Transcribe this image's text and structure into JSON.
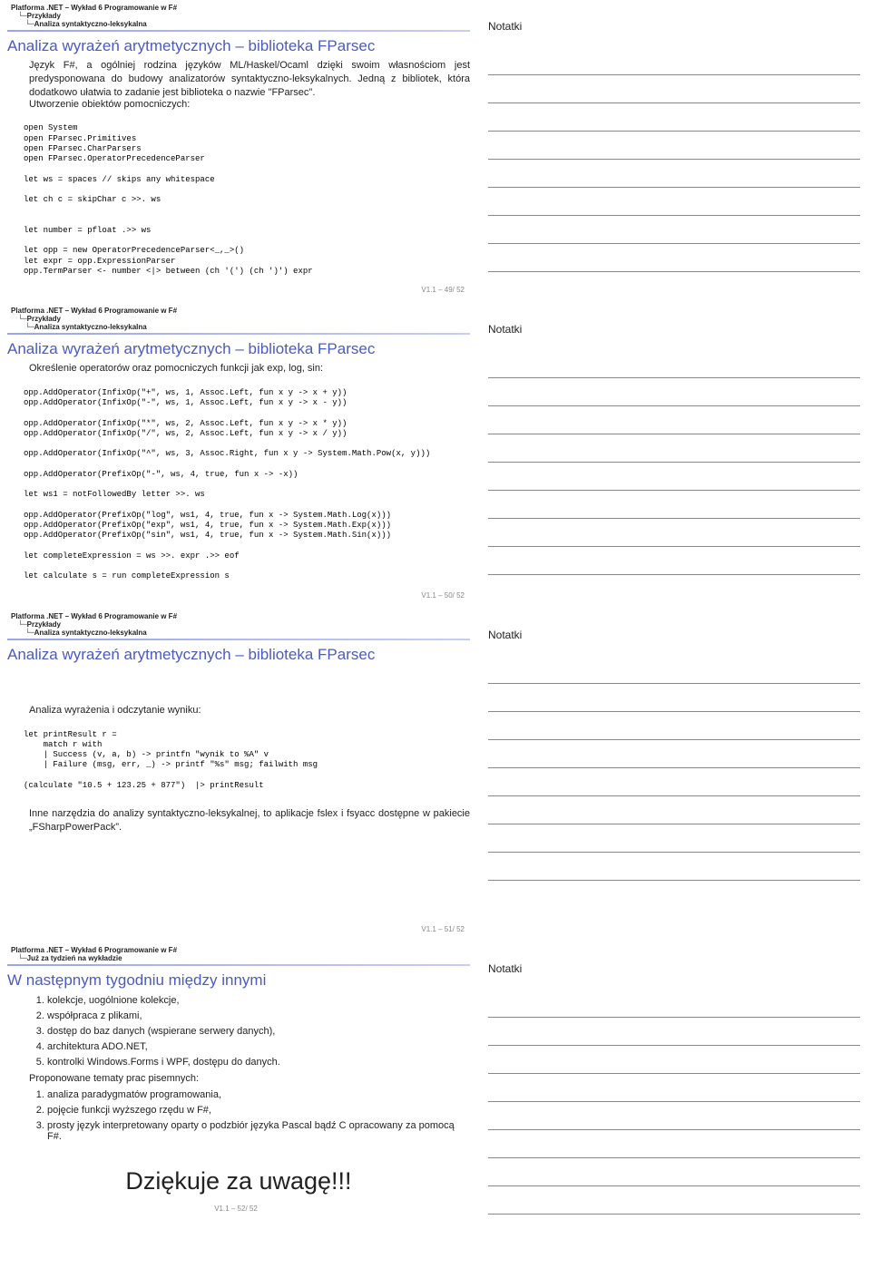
{
  "common": {
    "notesLabel": "Notatki",
    "crumbTitle": "Platforma .NET – Wykład 6  Programowanie w F#",
    "crumbSub1": "Przykłady",
    "crumbSub2": "Analiza syntaktyczno-leksykalna"
  },
  "slide49": {
    "title": "Analiza wyrażeń arytmetycznych – biblioteka FParsec",
    "paragraph": "Język F#, a ogólniej rodzina języków ML/Haskel/Ocaml dzięki swoim własnościom jest predysponowana do budowy analizatorów syntaktyczno-leksykalnych.  Jedną z bibliotek, która dodatkowo ułatwia to zadanie jest biblioteka o nazwie \"FParsec\".",
    "paragraph2": "Utworzenie obiektów pomocniczych:",
    "code": "open System\nopen FParsec.Primitives\nopen FParsec.CharParsers\nopen FParsec.OperatorPrecedenceParser\n\nlet ws = spaces // skips any whitespace\n\nlet ch c = skipChar c >>. ws\n\n\nlet number = pfloat .>> ws\n\nlet opp = new OperatorPrecedenceParser<_,_>()\nlet expr = opp.ExpressionParser\nopp.TermParser <- number <|> between (ch '(') (ch ')') expr",
    "footer": "V1.1 – 49/ 52"
  },
  "slide50": {
    "title": "Analiza wyrażeń arytmetycznych – biblioteka FParsec",
    "paragraph": "Określenie operatorów oraz pomocniczych funkcji jak exp, log, sin:",
    "code": "opp.AddOperator(InfixOp(\"+\", ws, 1, Assoc.Left, fun x y -> x + y))\nopp.AddOperator(InfixOp(\"-\", ws, 1, Assoc.Left, fun x y -> x - y))\n\nopp.AddOperator(InfixOp(\"*\", ws, 2, Assoc.Left, fun x y -> x * y))\nopp.AddOperator(InfixOp(\"/\", ws, 2, Assoc.Left, fun x y -> x / y))\n\nopp.AddOperator(InfixOp(\"^\", ws, 3, Assoc.Right, fun x y -> System.Math.Pow(x, y)))\n\nopp.AddOperator(PrefixOp(\"-\", ws, 4, true, fun x -> -x))\n\nlet ws1 = notFollowedBy letter >>. ws\n\nopp.AddOperator(PrefixOp(\"log\", ws1, 4, true, fun x -> System.Math.Log(x)))\nopp.AddOperator(PrefixOp(\"exp\", ws1, 4, true, fun x -> System.Math.Exp(x)))\nopp.AddOperator(PrefixOp(\"sin\", ws1, 4, true, fun x -> System.Math.Sin(x)))\n\nlet completeExpression = ws >>. expr .>> eof\n\nlet calculate s = run completeExpression s",
    "footer": "V1.1 – 50/ 52"
  },
  "slide51": {
    "title": "Analiza wyrażeń arytmetycznych – biblioteka FParsec",
    "paragraph": "Analiza wyrażenia i odczytanie wyniku:",
    "code": "let printResult r =\n    match r with\n    | Success (v, a, b) -> printfn \"wynik to %A\" v\n    | Failure (msg, err, _) -> printf \"%s\" msg; failwith msg\n\n(calculate \"10.5 + 123.25 + 877\")  |> printResult",
    "paragraph2": "Inne narzędzia do analizy syntaktyczno-leksykalnej, to aplikacje fslex i fsyacc dostępne w pakiecie „FSharpPowerPack”.",
    "footer": "V1.1 – 51/ 52"
  },
  "slide52": {
    "crumbSub1Alt": "Już za tydzień na wykładzie",
    "title": "W następnym tygodniu między innymi",
    "items": [
      "kolekcje, uogólnione kolekcje,",
      "współpraca z plikami,",
      "dostęp do baz danych (wspierane serwery danych),",
      "architektura ADO.NET,",
      "kontrolki Windows.Forms i WPF, dostępu do danych."
    ],
    "subhead": "Proponowane tematy prac pisemnych:",
    "items2": [
      "analiza paradygmatów programowania,",
      "pojęcie funkcji wyższego rzędu w F#,",
      "prosty język interpretowany oparty o podzbiór języka Pascal bądź C opracowany za pomocą F#."
    ],
    "thanks": "Dziękuje za uwagę!!!",
    "footer": "V1.1 – 52/ 52"
  }
}
